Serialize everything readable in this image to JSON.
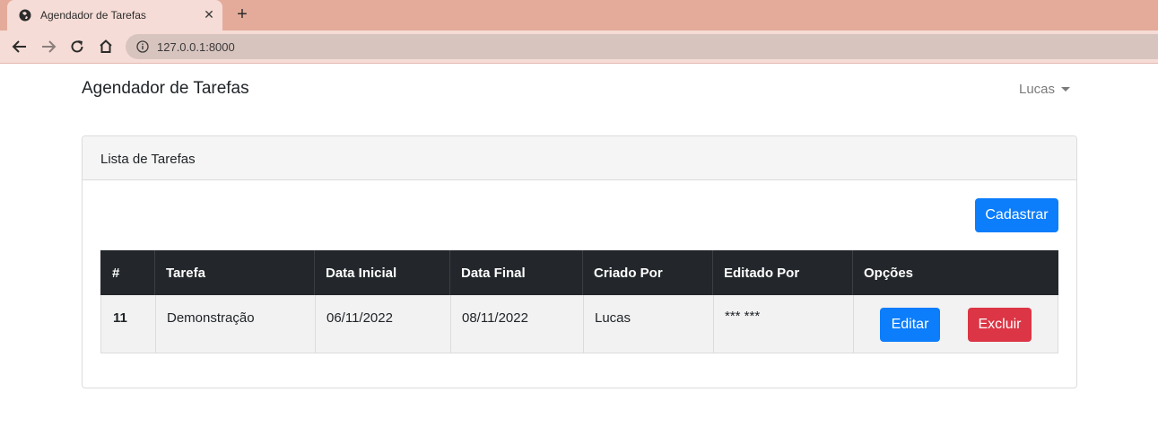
{
  "browser": {
    "tab_title": "Agendador de Tarefas",
    "tab_close": "✕",
    "new_tab": "+",
    "url": "127.0.0.1:8000"
  },
  "navbar": {
    "brand": "Agendador de Tarefas",
    "user": "Lucas"
  },
  "card": {
    "title": "Lista de Tarefas",
    "register_button": "Cadastrar"
  },
  "table": {
    "headers": [
      "#",
      "Tarefa",
      "Data Inicial",
      "Data Final",
      "Criado Por",
      "Editado Por",
      "Opções"
    ],
    "rows": [
      {
        "id": "11",
        "tarefa": "Demonstração",
        "data_inicial": "06/11/2022",
        "data_final": "08/11/2022",
        "criado_por": "Lucas",
        "editado_por": "*** ***",
        "edit_label": "Editar",
        "delete_label": "Excluir"
      }
    ]
  },
  "colors": {
    "primary": "#0c7dfb",
    "danger": "#dc3545",
    "table_header": "#23272b",
    "tabstrip": "#e4ab9b"
  }
}
